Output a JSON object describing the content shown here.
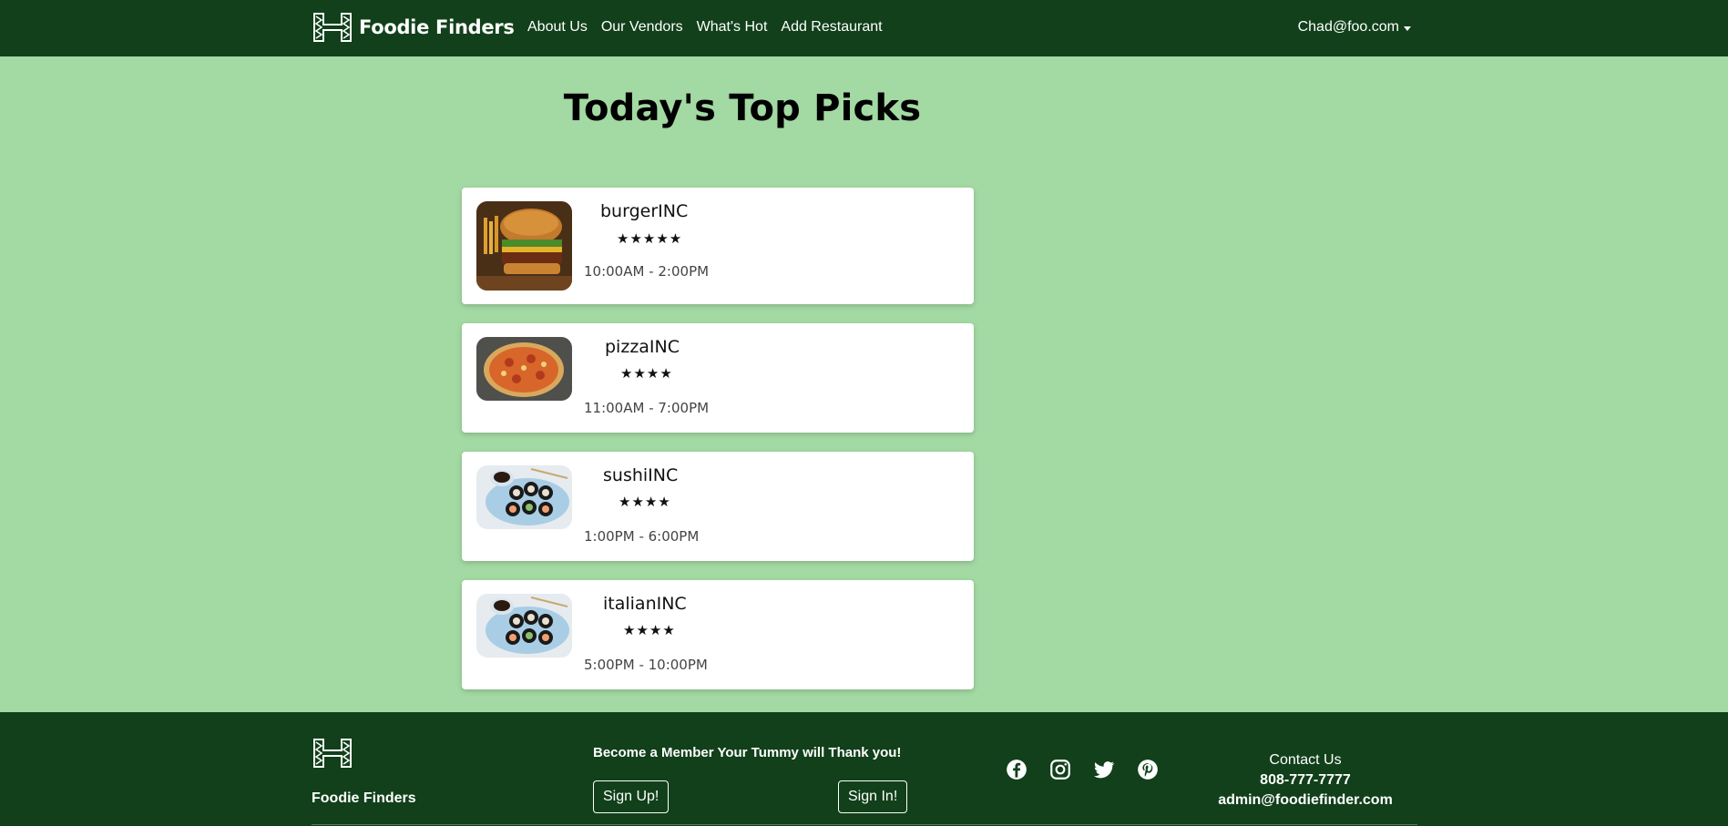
{
  "navbar": {
    "brand": "Foodie Finders",
    "links": [
      "About Us",
      "Our Vendors",
      "What's Hot",
      "Add Restaurant"
    ],
    "user": "Chad@foo.com"
  },
  "main": {
    "title": "Today's Top Picks",
    "picks": [
      {
        "name": "burgerINC",
        "stars": "★★★★★",
        "rating": 5,
        "hours": "10:00AM - 2:00PM",
        "image": "burger"
      },
      {
        "name": "pizzaINC",
        "stars": "★★★★",
        "rating": 4,
        "hours": "11:00AM - 7:00PM",
        "image": "pizza"
      },
      {
        "name": "sushiINC",
        "stars": "★★★★",
        "rating": 4,
        "hours": "1:00PM - 6:00PM",
        "image": "sushi"
      },
      {
        "name": "italianINC",
        "stars": "★★★★",
        "rating": 4,
        "hours": "5:00PM - 10:00PM",
        "image": "sushi"
      }
    ]
  },
  "footer": {
    "brand": "Foodie Finders",
    "tagline": "Become a Member Your Tummy will Thank you!",
    "signup_label": "Sign Up!",
    "signin_label": "Sign In!",
    "social_icons": [
      "facebook-icon",
      "instagram-icon",
      "twitter-icon",
      "pinterest-icon"
    ],
    "contact_heading": "Contact Us",
    "phone": "808-777-7777",
    "email": "admin@foodiefinder.com"
  },
  "colors": {
    "nav_bg": "#11401a",
    "page_bg": "#a3d9a3",
    "card_bg": "#ffffff"
  }
}
